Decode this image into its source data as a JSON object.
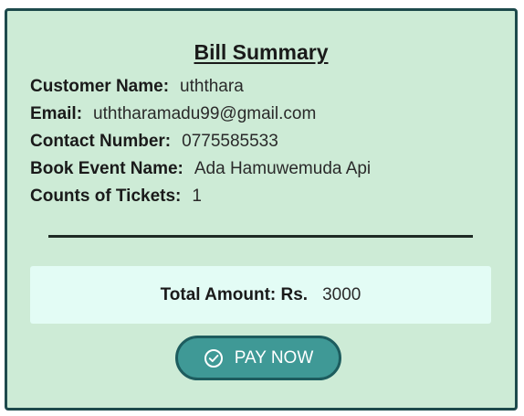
{
  "bill": {
    "title": "Bill Summary",
    "rows": [
      {
        "label": "Customer Name:",
        "value": "uththara"
      },
      {
        "label": "Email:",
        "value": "uththaramadu99@gmail.com"
      },
      {
        "label": "Contact Number:",
        "value": "0775585533"
      },
      {
        "label": "Book Event Name:",
        "value": "Ada Hamuwemuda Api"
      },
      {
        "label": "Counts of Tickets:",
        "value": "1"
      }
    ],
    "total": {
      "label": "Total Amount: Rs.",
      "value": "3000"
    },
    "pay_button": {
      "label": "PAY NOW",
      "icon": "check-circle-icon"
    }
  },
  "colors": {
    "card_bg": "#cdebd6",
    "card_border": "#1d4a4c",
    "total_bg": "#e3fcf5",
    "button_bg": "#3f9996",
    "button_border": "#1d5c5e"
  }
}
